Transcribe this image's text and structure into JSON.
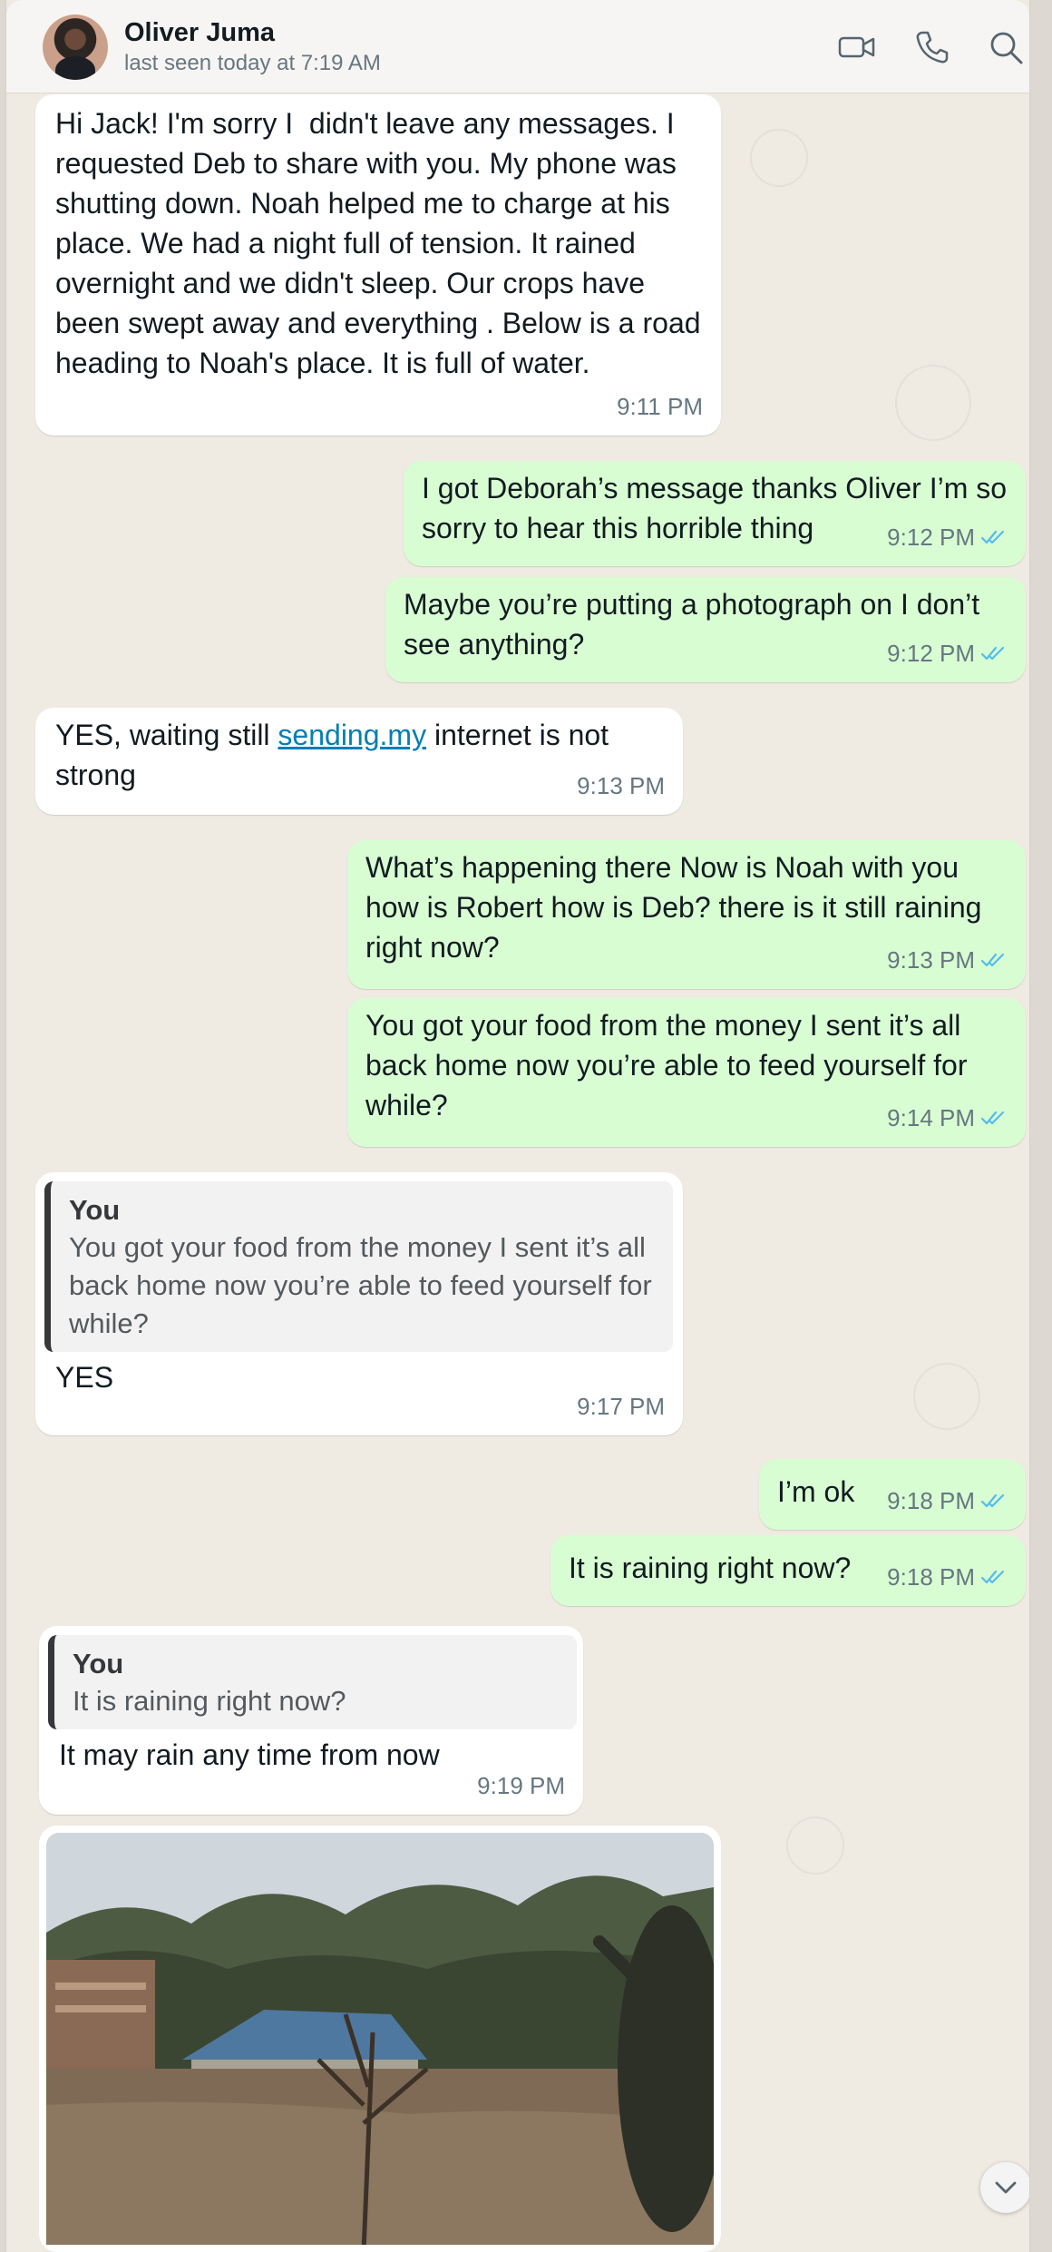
{
  "contact": {
    "name": "Oliver Juma",
    "status": "last seen today at 7:19 AM"
  },
  "header_icons": [
    "video-call-icon",
    "phone-call-icon",
    "search-icon"
  ],
  "messages": [
    {
      "dir": "in",
      "text": "Hi Jack! I'm sorry I  didn't leave any messages. I requested Deb to share with you. My phone was shutting down. Noah helped me to charge at his place. We had a night full of tension. It rained overnight and we didn't sleep. Our crops have been swept away and everything . Below is a road heading to Noah's place. It is full of water.",
      "time": "9:11 PM"
    },
    {
      "dir": "out",
      "text": "I got Deborah’s message thanks Oliver I’m so sorry to hear this horrible thing",
      "time": "9:12 PM"
    },
    {
      "dir": "out",
      "text": "Maybe you’re putting a photograph on I don’t see anything?",
      "time": "9:12 PM"
    },
    {
      "dir": "in",
      "text_before": "YES, waiting still ",
      "link": "sending.my",
      "text_after": " internet is not strong",
      "time": "9:13 PM"
    },
    {
      "dir": "out",
      "text": "What’s happening there Now is Noah with you how is Robert how is Deb? there is it still raining right now?",
      "time": "9:13 PM"
    },
    {
      "dir": "out",
      "text": "You got your food from the money I sent it’s all back home now you’re able to feed yourself for while?",
      "time": "9:14 PM"
    },
    {
      "dir": "in",
      "quote_name": "You",
      "quote_text": "You got your food from the money I sent it’s all back home now you’re able to feed yourself for while?",
      "text": "YES",
      "time": "9:17 PM"
    },
    {
      "dir": "out",
      "text": "I’m ok",
      "time": "9:18 PM"
    },
    {
      "dir": "out",
      "text": "It is raining right now?",
      "time": "9:18 PM"
    },
    {
      "dir": "in",
      "quote_name": "You",
      "quote_text": "It is raining right now?",
      "text": "It may rain any time from now",
      "time": "9:19 PM"
    }
  ],
  "photo": {
    "subject": "flooded-road-photo"
  },
  "colors": {
    "incoming_bubble": "#ffffff",
    "outgoing_bubble": "#d9fdd3",
    "chat_background": "#efeae2",
    "read_ticks": "#53bdeb",
    "link": "#027eb5"
  }
}
